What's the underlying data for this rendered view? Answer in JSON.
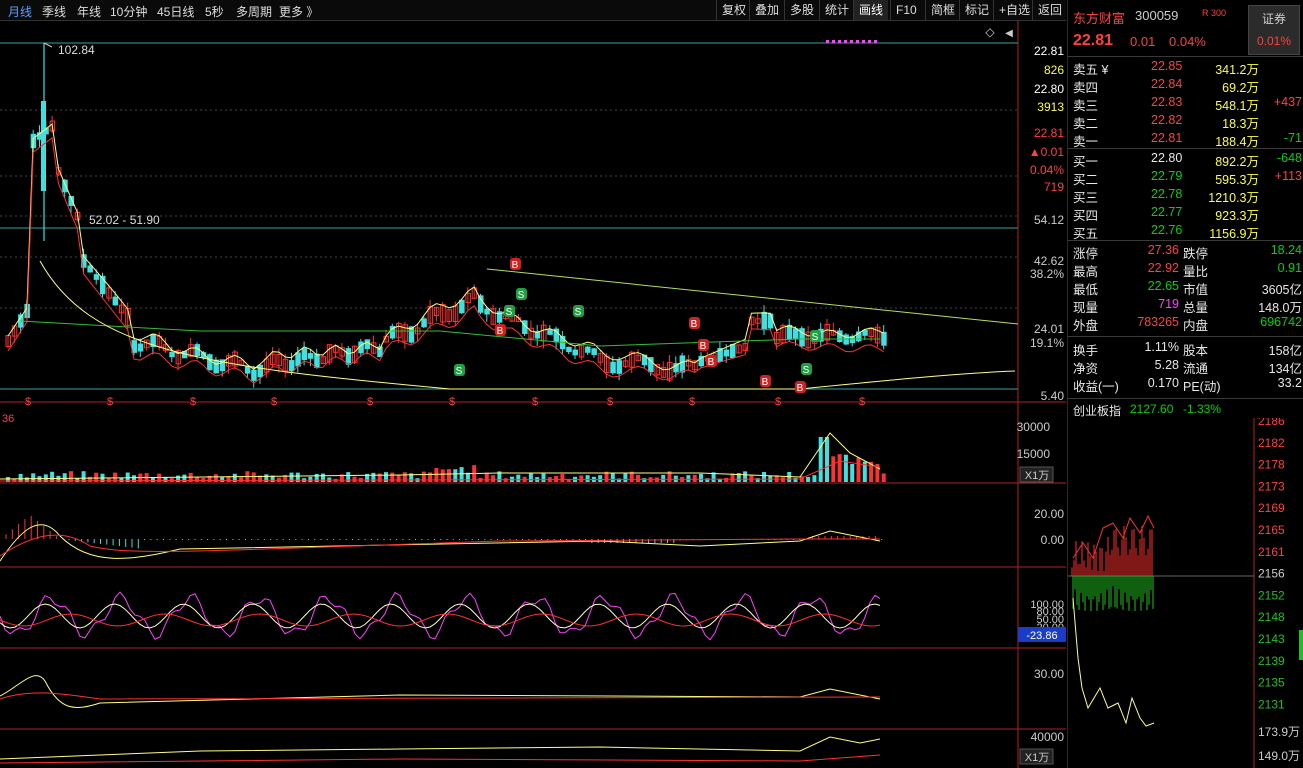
{
  "toolbar": {
    "periods": [
      "月线",
      "季线",
      "年线",
      "10分钟",
      "45日线",
      "5秒",
      "多周期",
      "更多 》"
    ],
    "tools": [
      "复权",
      "叠加",
      "多股",
      "统计",
      "画线",
      "F10",
      "简框",
      "标记",
      "+自选",
      "返回"
    ],
    "active_period": "月线",
    "active_tool": "画线"
  },
  "chart": {
    "high_label": "102.84",
    "range_label": "52.02 - 51.90",
    "left_label": "36",
    "price_axis": [
      "22.81",
      "826",
      "22.80",
      "3913",
      "22.81",
      "▲0.01",
      "0.04%",
      "719",
      "54.12",
      "42.62",
      "38.2%",
      "24.01",
      "19.1%",
      "5.40"
    ],
    "volume_axis": [
      "30000",
      "15000",
      "X1万"
    ],
    "macd_axis": [
      "20.00",
      "0.00"
    ],
    "kdj_axis": [
      "100.00",
      "80.00",
      "50.00",
      "20.00"
    ],
    "kdj_value": "-23.86",
    "ind4_axis": [
      "30.00"
    ],
    "ind5_axis": [
      "40000",
      "X1万"
    ],
    "markers": {
      "b": "B",
      "s": "S",
      "div": "$"
    }
  },
  "quote": {
    "name": "东方财富",
    "code": "300059",
    "tag": "R 300",
    "badge_title": "证券",
    "badge_value": "0.01%",
    "price": "22.81",
    "change": "0.01",
    "change_pct": "0.04%",
    "sells": [
      {
        "label": "卖五 ¥",
        "price": "22.85",
        "vol": "341.2万",
        "chg": ""
      },
      {
        "label": "卖四",
        "price": "22.84",
        "vol": "69.2万",
        "chg": ""
      },
      {
        "label": "卖三",
        "price": "22.83",
        "vol": "548.1万",
        "chg": "+437"
      },
      {
        "label": "卖二",
        "price": "22.82",
        "vol": "18.3万",
        "chg": ""
      },
      {
        "label": "卖一",
        "price": "22.81",
        "vol": "188.4万",
        "chg": "-71"
      }
    ],
    "buys": [
      {
        "label": "买一",
        "price": "22.80",
        "vol": "892.2万",
        "chg": "-648"
      },
      {
        "label": "买二",
        "price": "22.79",
        "vol": "595.3万",
        "chg": "+113"
      },
      {
        "label": "买三",
        "price": "22.78",
        "vol": "1210.3万",
        "chg": ""
      },
      {
        "label": "买四",
        "price": "22.77",
        "vol": "923.3万",
        "chg": ""
      },
      {
        "label": "买五",
        "price": "22.76",
        "vol": "1156.9万",
        "chg": ""
      }
    ],
    "stats": [
      {
        "l1": "涨停",
        "v1": "27.36",
        "l2": "跌停",
        "v2": "18.24",
        "c1": "red",
        "c2": "green"
      },
      {
        "l1": "最高",
        "v1": "22.92",
        "l2": "量比",
        "v2": "0.91",
        "c1": "red",
        "c2": "green"
      },
      {
        "l1": "最低",
        "v1": "22.65",
        "l2": "市值",
        "v2": "3605亿",
        "c1": "green",
        "c2": "white"
      },
      {
        "l1": "现量",
        "v1": "719",
        "l2": "总量",
        "v2": "148.0万",
        "c1": "mag",
        "c2": "white"
      },
      {
        "l1": "外盘",
        "v1": "783265",
        "l2": "内盘",
        "v2": "696742",
        "c1": "red",
        "c2": "green"
      }
    ],
    "stats2": [
      {
        "l1": "换手",
        "v1": "1.11%",
        "l2": "股本",
        "v2": "158亿"
      },
      {
        "l1": "净资",
        "v1": "5.28",
        "l2": "流通",
        "v2": "134亿"
      },
      {
        "l1": "收益(一)",
        "v1": "0.170",
        "l2": "PE(动)",
        "v2": "33.2"
      }
    ]
  },
  "index": {
    "name": "创业板指",
    "value": "2127.60",
    "pct": "-1.33%",
    "axis": [
      "2186",
      "2182",
      "2178",
      "2173",
      "2169",
      "2165",
      "2161",
      "2156",
      "2152",
      "2148",
      "2143",
      "2139",
      "2135",
      "2131"
    ],
    "vol_axis": [
      "173.9万",
      "149.0万"
    ]
  }
}
